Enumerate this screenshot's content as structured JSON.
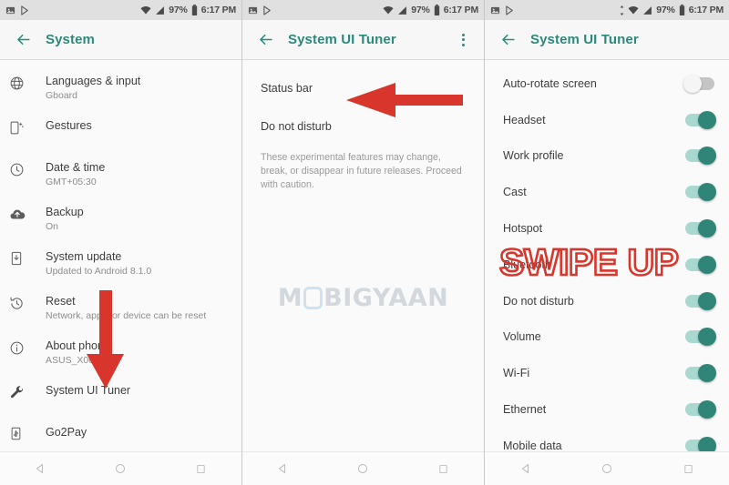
{
  "status_bar": {
    "left_icons": [
      "screenshot-icon",
      "play-store-icon"
    ],
    "wifi_icon": "wifi-icon",
    "signal_icon": "cellular-signal-icon",
    "battery_percent": "97%",
    "battery_icon": "battery-icon",
    "time": "6:17 PM"
  },
  "nav_bar": {
    "back": "back-triangle-icon",
    "home": "home-circle-icon",
    "recents": "recents-square-icon"
  },
  "panels": [
    {
      "title": "System",
      "back_label": "Back",
      "has_overflow": false,
      "items": [
        {
          "icon": "globe-icon",
          "title": "Languages & input",
          "subtitle": "Gboard"
        },
        {
          "icon": "gestures-icon",
          "title": "Gestures",
          "subtitle": ""
        },
        {
          "icon": "clock-icon",
          "title": "Date & time",
          "subtitle": "GMT+05:30"
        },
        {
          "icon": "cloud-upload-icon",
          "title": "Backup",
          "subtitle": "On"
        },
        {
          "icon": "system-update-icon",
          "title": "System update",
          "subtitle": "Updated to Android 8.1.0"
        },
        {
          "icon": "reset-icon",
          "title": "Reset",
          "subtitle": "Network, apps, or device can be reset"
        },
        {
          "icon": "info-icon",
          "title": "About phone",
          "subtitle": "ASUS_X00"
        },
        {
          "icon": "wrench-icon",
          "title": "System UI Tuner",
          "subtitle": ""
        },
        {
          "icon": "go2pay-icon",
          "title": "Go2Pay",
          "subtitle": ""
        }
      ]
    },
    {
      "title": "System UI Tuner",
      "back_label": "Back",
      "has_overflow": true,
      "overflow_label": "More options",
      "items": [
        {
          "title": "Status bar"
        },
        {
          "title": "Do not disturb"
        }
      ],
      "note": "These experimental features may change, break, or disappear in future releases. Proceed with caution.",
      "watermark": {
        "before": "M",
        "after": "BIGYAAN"
      }
    },
    {
      "title": "System UI Tuner",
      "back_label": "Back",
      "has_overflow": false,
      "toggles": [
        {
          "label": "Auto-rotate screen",
          "on": false
        },
        {
          "label": "Headset",
          "on": true
        },
        {
          "label": "Work profile",
          "on": true
        },
        {
          "label": "Cast",
          "on": true
        },
        {
          "label": "Hotspot",
          "on": true
        },
        {
          "label": "Bluetooth",
          "on": true
        },
        {
          "label": "Do not disturb",
          "on": true
        },
        {
          "label": "Volume",
          "on": true
        },
        {
          "label": "Wi-Fi",
          "on": true
        },
        {
          "label": "Ethernet",
          "on": true
        },
        {
          "label": "Mobile data",
          "on": true
        }
      ]
    }
  ],
  "annotations": {
    "arrow_down_label": "down-arrow-annotation",
    "arrow_left_label": "left-arrow-annotation",
    "swipe_up_text": "SWIPE UP"
  },
  "colors": {
    "accent_teal": "#2a8a7c",
    "annotation_red": "#d8362c",
    "switch_on_track": "#a8d8d0",
    "switch_on_thumb": "#2f8577",
    "switch_off_track": "#c4c4c4"
  }
}
